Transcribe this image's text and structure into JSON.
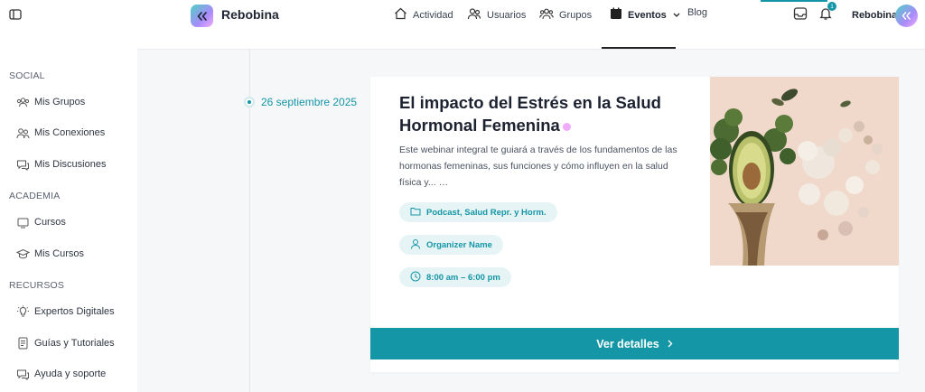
{
  "app": {
    "brand": "Rebobina",
    "user_name": "Rebobina",
    "notifications_count": "1",
    "accent": "#1596a6"
  },
  "sidebar": {
    "sections": [
      {
        "title": "SOCIAL",
        "items": [
          {
            "label": "Mis Grupos",
            "icon": "group-icon"
          },
          {
            "label": "Mis Conexiones",
            "icon": "connections-icon"
          },
          {
            "label": "Mis Discusiones",
            "icon": "discussions-icon"
          }
        ]
      },
      {
        "title": "ACADEMIA",
        "items": [
          {
            "label": "Cursos",
            "icon": "courses-icon"
          },
          {
            "label": "Mis Cursos",
            "icon": "graduation-cap-icon"
          }
        ]
      },
      {
        "title": "RECURSOS",
        "items": [
          {
            "label": "Expertos Digitales",
            "icon": "lightbulb-icon"
          },
          {
            "label": "Guías y Tutoriales",
            "icon": "document-icon"
          },
          {
            "label": "Ayuda y soporte",
            "icon": "support-chat-icon"
          }
        ]
      }
    ]
  },
  "topnav": {
    "actividad": "Actividad",
    "usuarios": "Usuarios",
    "grupos": "Grupos",
    "eventos": "Eventos",
    "blog": "Blog"
  },
  "event": {
    "date": "26 septiembre 2025",
    "title": "El impacto del Estrés en la Salud Hormonal Femenina",
    "description": "Este webinar integral te guiará a través de los fundamentos de las hormonas femeninas, sus funciones y cómo influyen en la salud física y... …",
    "categories": "Podcast,  Salud Repr. y Horm.",
    "organizer": "Organizer Name",
    "time": "8:00 am – 6:00 pm",
    "cta_label": "Ver detalles"
  }
}
